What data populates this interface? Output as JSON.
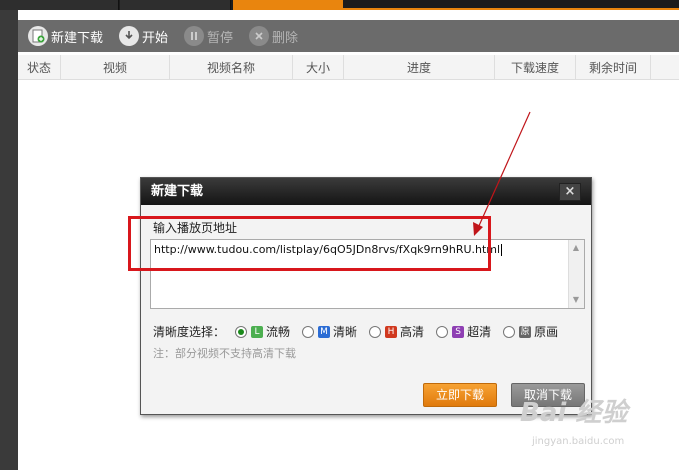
{
  "toolbar": {
    "new_download": "新建下载",
    "start": "开始",
    "pause": "暂停",
    "delete": "删除"
  },
  "columns": [
    "状态",
    "视频",
    "视频名称",
    "大小",
    "进度",
    "下载速度",
    "剩余时间"
  ],
  "dialog": {
    "title": "新建下载",
    "close": "×",
    "url_label": "输入播放页地址",
    "url_value": "http://www.tudou.com/listplay/6qO5JDn8rvs/fXqk9rn9hRU.html",
    "quality_label": "清晰度选择：",
    "qualities": [
      {
        "badge": "L",
        "label": "流畅",
        "color": "#4caf50",
        "selected": true
      },
      {
        "badge": "M",
        "label": "清晰",
        "color": "#2b6cd4",
        "selected": false
      },
      {
        "badge": "H",
        "label": "高清",
        "color": "#d0381e",
        "selected": false
      },
      {
        "badge": "S",
        "label": "超清",
        "color": "#8e3fb3",
        "selected": false
      },
      {
        "badge": "原",
        "label": "原画",
        "color": "#666666",
        "selected": false
      }
    ],
    "note": "注：部分视频不支持高清下载",
    "ok_label": "立即下载",
    "cancel_label": "取消下载"
  },
  "watermark": {
    "brand": "Bai 经验",
    "url": "jingyan.baidu.com"
  },
  "colors": {
    "accent_orange": "#e9850e",
    "annotation_red": "#d8171c"
  }
}
